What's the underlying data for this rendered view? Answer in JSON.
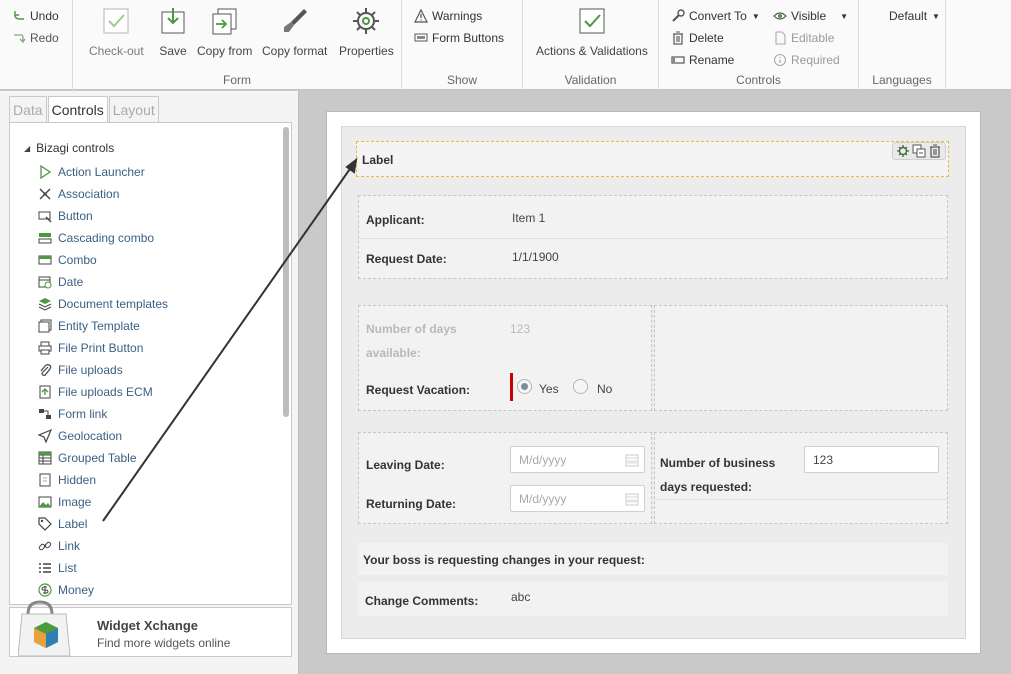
{
  "ribbon": {
    "undo": "Undo",
    "redo": "Redo",
    "form_group": {
      "title": "Form",
      "checkout": "Check-out",
      "save": "Save",
      "copy_from": "Copy from",
      "copy_format": "Copy format",
      "properties": "Properties"
    },
    "show_group": {
      "title": "Show",
      "warnings": "Warnings",
      "form_buttons": "Form Buttons"
    },
    "validation_group": {
      "title": "Validation",
      "actions_validations": "Actions & Validations"
    },
    "controls_group": {
      "title": "Controls",
      "convert_to": "Convert To",
      "delete": "Delete",
      "rename": "Rename",
      "visible": "Visible",
      "editable": "Editable",
      "required": "Required"
    },
    "languages_group": {
      "title": "Languages",
      "language": "Default"
    }
  },
  "left_panel": {
    "tabs": [
      "Data",
      "Controls",
      "Layout"
    ],
    "active_tab": "Controls",
    "tree_root": "Bizagi controls",
    "items": [
      {
        "label": "Action Launcher",
        "icon": "play-triangle-icon"
      },
      {
        "label": "Association",
        "icon": "association-icon"
      },
      {
        "label": "Button",
        "icon": "button-icon"
      },
      {
        "label": "Cascading combo",
        "icon": "cascading-combo-icon"
      },
      {
        "label": "Combo",
        "icon": "combo-icon"
      },
      {
        "label": "Date",
        "icon": "calendar-icon"
      },
      {
        "label": "Document templates",
        "icon": "document-templates-icon"
      },
      {
        "label": "Entity Template",
        "icon": "entity-template-icon"
      },
      {
        "label": "File Print Button",
        "icon": "printer-icon"
      },
      {
        "label": "File uploads",
        "icon": "paperclip-icon"
      },
      {
        "label": "File uploads ECM",
        "icon": "file-upload-ecm-icon"
      },
      {
        "label": "Form link",
        "icon": "form-link-icon"
      },
      {
        "label": "Geolocation",
        "icon": "geolocation-icon"
      },
      {
        "label": "Grouped Table",
        "icon": "grouped-table-icon"
      },
      {
        "label": "Hidden",
        "icon": "hidden-icon"
      },
      {
        "label": "Image",
        "icon": "image-icon"
      },
      {
        "label": "Label",
        "icon": "label-tag-icon"
      },
      {
        "label": "Link",
        "icon": "link-icon"
      },
      {
        "label": "List",
        "icon": "list-icon"
      },
      {
        "label": "Money",
        "icon": "money-icon"
      }
    ],
    "widget": {
      "title": "Widget Xchange",
      "subtitle": "Find more widgets online"
    }
  },
  "form": {
    "label_control": "Label",
    "applicant_label": "Applicant:",
    "applicant_value": "Item 1",
    "request_date_label": "Request Date:",
    "request_date_value": "1/1/1900",
    "days_available_label_1": "Number of days",
    "days_available_label_2": "available:",
    "days_available_value": "123",
    "request_vacation_label": "Request Vacation:",
    "radio_yes": "Yes",
    "radio_no": "No",
    "radio_selected": "Yes",
    "leaving_date_label": "Leaving Date:",
    "leaving_date_placeholder": "M/d/yyyy",
    "returning_date_label": "Returning Date:",
    "returning_date_placeholder": "M/d/yyyy",
    "business_days_label_1": "Number of business",
    "business_days_label_2": "days requested:",
    "business_days_value": "123",
    "boss_message": "Your boss is requesting changes in your request:",
    "change_comments_label": "Change Comments:",
    "change_comments_value": "abc"
  },
  "colors": {
    "required_marker": "#cc0000",
    "selection_border": "#e2bf3a",
    "tree_link": "#3a5f82",
    "icon_green": "#4a9a3e"
  }
}
